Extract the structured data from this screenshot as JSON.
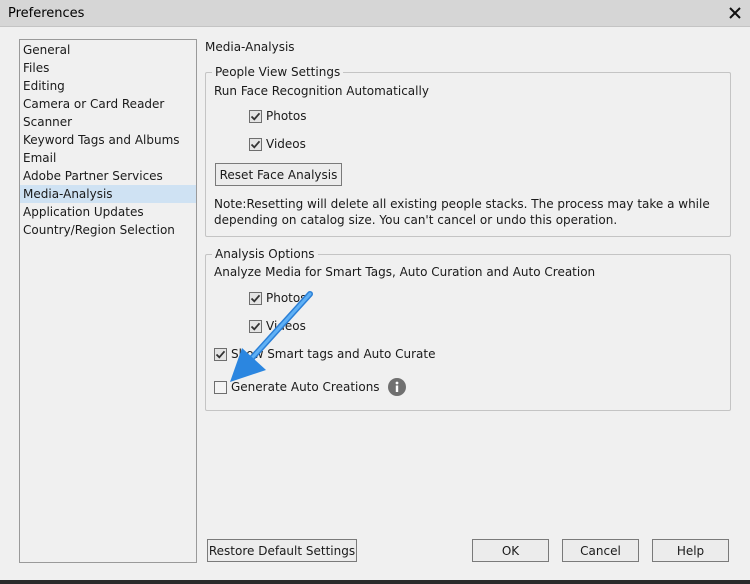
{
  "window": {
    "title": "Preferences"
  },
  "sidebar": {
    "items": [
      {
        "label": "General"
      },
      {
        "label": "Files"
      },
      {
        "label": "Editing"
      },
      {
        "label": "Camera or Card Reader"
      },
      {
        "label": "Scanner"
      },
      {
        "label": "Keyword Tags and Albums"
      },
      {
        "label": "Email"
      },
      {
        "label": "Adobe Partner Services"
      },
      {
        "label": "Media-Analysis",
        "selected": true
      },
      {
        "label": "Application Updates"
      },
      {
        "label": "Country/Region Selection"
      }
    ]
  },
  "main": {
    "title": "Media-Analysis",
    "people_view": {
      "legend": "People View Settings",
      "heading": "Run Face Recognition Automatically",
      "photos": {
        "label": "Photos",
        "checked": true
      },
      "videos": {
        "label": "Videos",
        "checked": true
      },
      "reset_button": "Reset Face Analysis",
      "note_line1": "Note:Resetting will delete all existing people stacks. The process may take a while",
      "note_line2": "depending on catalog size. You can't cancel or undo this operation."
    },
    "analysis": {
      "legend": "Analysis Options",
      "heading": "Analyze Media for Smart Tags, Auto Curation and Auto Creation",
      "photos": {
        "label": "Photos",
        "checked": true
      },
      "videos": {
        "label": "Videos",
        "checked": true
      },
      "show_smart": {
        "label": "Show Smart tags and Auto Curate",
        "checked": true
      },
      "generate_auto": {
        "label": "Generate Auto Creations",
        "checked": false
      }
    }
  },
  "footer": {
    "restore_button": "Restore Default Settings",
    "ok_button": "OK",
    "cancel_button": "Cancel",
    "help_button": "Help"
  },
  "colors": {
    "background": "#f0f0f0",
    "selected_item": "#cfe2f3",
    "annotation_arrow": "#1e88e5"
  },
  "icons": {
    "close": "close-icon",
    "check": "check-icon",
    "info": "info-icon",
    "arrow": "annotation-arrow"
  }
}
